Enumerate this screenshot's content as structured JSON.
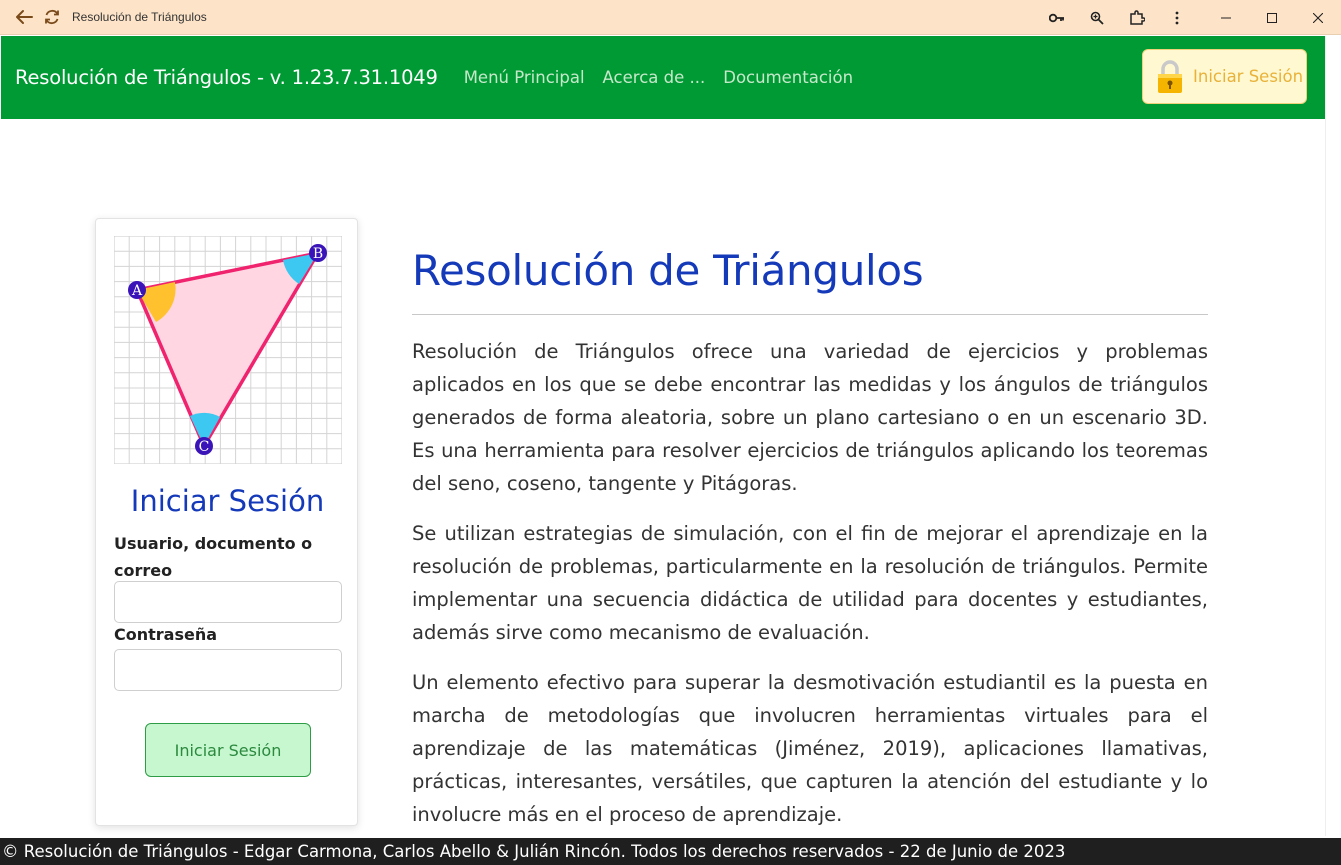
{
  "browser": {
    "tab_title": "Resolución de Triángulos",
    "icons": [
      "back-arrow-icon",
      "reload-icon",
      "key-icon",
      "zoom-icon",
      "extensions-icon",
      "more-icon"
    ]
  },
  "navbar": {
    "brand": "Resolución de Triángulos - v. 1.23.7.31.1049",
    "links": [
      "Menú Principal",
      "Acerca de ...",
      "Documentación"
    ],
    "login_button": "Iniciar Sesión",
    "bg_color": "#009a35"
  },
  "login_card": {
    "triangle_labels": [
      "A",
      "B",
      "C"
    ],
    "title": "Iniciar Sesión",
    "user_label": "Usuario, documento o correo",
    "user_value": "",
    "password_label": "Contraseña",
    "password_value": "",
    "submit_label": "Iniciar Sesión"
  },
  "main": {
    "title": "Resolución de Triángulos",
    "paragraphs": [
      "Resolución de Triángulos ofrece una variedad de ejercicios y problemas aplicados en los que se debe encontrar las medidas y los ángulos de triángulos generados de forma aleatoria, sobre un plano cartesiano o en un escenario 3D. Es una herramienta para resolver ejercicios de triángulos aplicando los teoremas del seno, coseno, tangente y Pitágoras.",
      "Se utilizan estrategias de simulación, con el fin de mejorar el aprendizaje en la resolución de problemas, particularmente en la resolución de triángulos. Permite implementar una secuencia didáctica de utilidad para docentes y estudiantes, además sirve como mecanismo de evaluación.",
      "Un elemento efectivo para superar la desmotivación estudiantil es la puesta en marcha de metodologías que involucren herramientas virtuales para el aprendizaje de las matemáticas (Jiménez, 2019), aplicaciones llamativas, prácticas, interesantes, versátiles, que capturen la atención del estudiante y lo involucre más en el proceso de aprendizaje."
    ]
  },
  "footer": {
    "text": "© Resolución de Triángulos - Edgar Carmona, Carlos Abello & Julián Rincón. Todos los derechos reservados - 22 de Junio de 2023"
  }
}
